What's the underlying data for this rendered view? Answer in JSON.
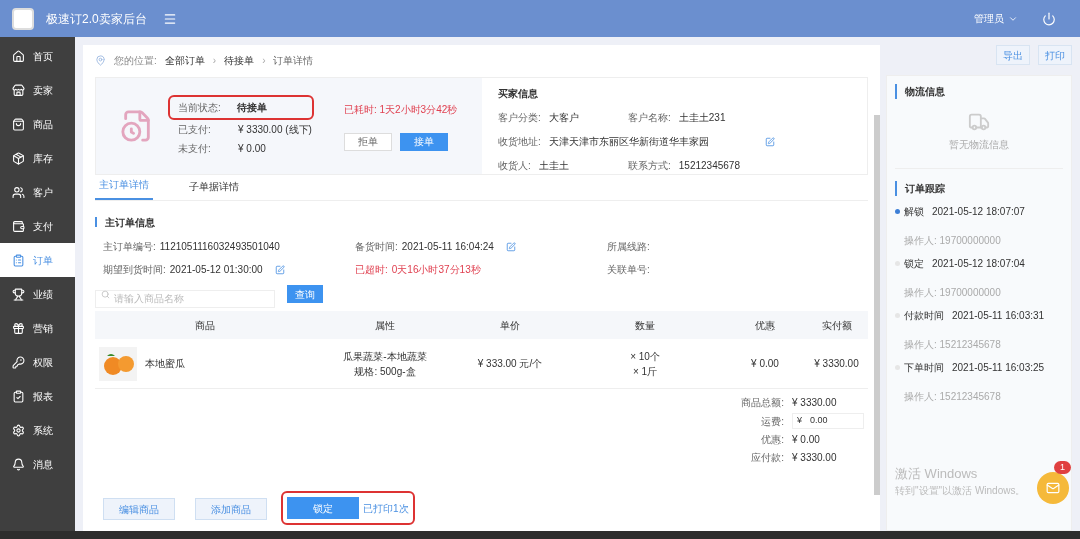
{
  "header": {
    "title": "极速订2.0卖家后台",
    "user": "管理员"
  },
  "sidebar": {
    "items": [
      {
        "label": "首页",
        "selected": false
      },
      {
        "label": "卖家",
        "selected": false
      },
      {
        "label": "商品",
        "selected": false
      },
      {
        "label": "库存",
        "selected": false
      },
      {
        "label": "客户",
        "selected": false
      },
      {
        "label": "支付",
        "selected": false
      },
      {
        "label": "订单",
        "selected": true
      },
      {
        "label": "业绩",
        "selected": false
      },
      {
        "label": "营销",
        "selected": false
      },
      {
        "label": "权限",
        "selected": false
      },
      {
        "label": "报表",
        "selected": false
      },
      {
        "label": "系统",
        "selected": false
      },
      {
        "label": "消息",
        "selected": false
      }
    ]
  },
  "breadcrumb": {
    "prefix": "您的位置:",
    "separator": "›",
    "items": [
      "全部订单",
      "待接单",
      "订单详情"
    ]
  },
  "actions": [
    "导出",
    "打印"
  ],
  "status": {
    "label": "当前状态:",
    "value": "待接单",
    "highlighted": true,
    "elapsed": "已耗时: 1天2小时3分42秒",
    "rows": [
      {
        "label": "已支付:",
        "value": "¥ 3330.00 (线下)"
      },
      {
        "label": "未支付:",
        "value": "¥ 0.00"
      }
    ],
    "buttons": [
      {
        "label": "拒单",
        "kind": "secondary"
      },
      {
        "label": "接单",
        "kind": "primary"
      }
    ]
  },
  "buyer": {
    "title": "买家信息",
    "fields": [
      {
        "label": "客户分类:",
        "value": "大客户",
        "editable": false
      },
      {
        "label": "客户名称:",
        "value": "土圭土231",
        "editable": false
      },
      {
        "label": "收货地址:",
        "value": "天津天津市东丽区华新街道华丰家园",
        "editable": true
      },
      {
        "label": "收货人:",
        "value": "土圭土",
        "editable": false
      },
      {
        "label": "联系方式:",
        "value": "15212345678",
        "editable": false
      }
    ]
  },
  "tabs": [
    {
      "label": "主订单详情",
      "selected": true
    },
    {
      "label": "子单据详情",
      "selected": false
    }
  ],
  "order_info": {
    "title": "主订单信息",
    "fields": [
      {
        "label": "主订单编号:",
        "value": "1121051116032493501040",
        "editable": false,
        "alert": false
      },
      {
        "label": "备货时间:",
        "value": "2021-05-11 16:04:24",
        "editable": true,
        "alert": false
      },
      {
        "label": "所属线路:",
        "editable": false,
        "alert": false
      },
      {
        "label": "期望到货时间:",
        "value": "2021-05-12 01:30:00",
        "editable": true,
        "alert": false
      },
      {
        "label": "已超时:",
        "value": "0天16小时37分13秒",
        "editable": false,
        "alert": true
      },
      {
        "label": "关联单号:",
        "editable": false,
        "alert": false
      }
    ]
  },
  "search": {
    "placeholder": "请输入商品名称",
    "button": "查询"
  },
  "table": {
    "columns": [
      "商品",
      "属性",
      "单价",
      "数量",
      "优惠",
      "实付额"
    ],
    "rows": [
      {
        "name": "本地蜜瓜",
        "attrs": [
          "瓜果蔬菜-本地蔬菜",
          "规格: 500g-盒"
        ],
        "price": "¥ 333.00 元/个",
        "qty": [
          "× 10个",
          "× 1斤"
        ],
        "discount": "¥ 0.00",
        "paid": "¥ 3330.00"
      }
    ]
  },
  "totals": [
    {
      "label": "商品总额:",
      "value": "¥ 3330.00",
      "kind": "text"
    },
    {
      "label": "运费:",
      "value": "0.00",
      "kind": "input",
      "prefix": "¥"
    },
    {
      "label": "优惠:",
      "value": "¥ 0.00",
      "kind": "text"
    },
    {
      "label": "应付款:",
      "value": "¥ 3330.00",
      "kind": "text"
    }
  ],
  "footer": {
    "buttons": [
      {
        "label": "编辑商品",
        "highlighted": false,
        "kind": "light"
      },
      {
        "label": "添加商品",
        "highlighted": false,
        "kind": "light"
      },
      {
        "label": "锁定",
        "highlighted": true,
        "kind": "primary"
      }
    ],
    "note": "已打印1次"
  },
  "logistics": {
    "title": "物流信息",
    "empty": "暂无物流信息"
  },
  "tracking": {
    "title": "订单跟踪",
    "events": [
      {
        "action": "解锁",
        "time": "2021-05-12 18:07:07",
        "operator": "操作人: 19700000000",
        "selected": true
      },
      {
        "action": "锁定",
        "time": "2021-05-12 18:07:04",
        "operator": "操作人: 19700000000",
        "selected": false
      },
      {
        "action": "付款时间",
        "time": "2021-05-11 16:03:31",
        "operator": "操作人: 15212345678",
        "selected": false
      },
      {
        "action": "下单时间",
        "time": "2021-05-11 16:03:25",
        "operator": "操作人: 15212345678",
        "selected": false
      }
    ]
  },
  "os_notice": {
    "title": "激活 Windows",
    "text": "转到\"设置\"以激活 Windows。"
  },
  "chat": {
    "badge": "1"
  }
}
